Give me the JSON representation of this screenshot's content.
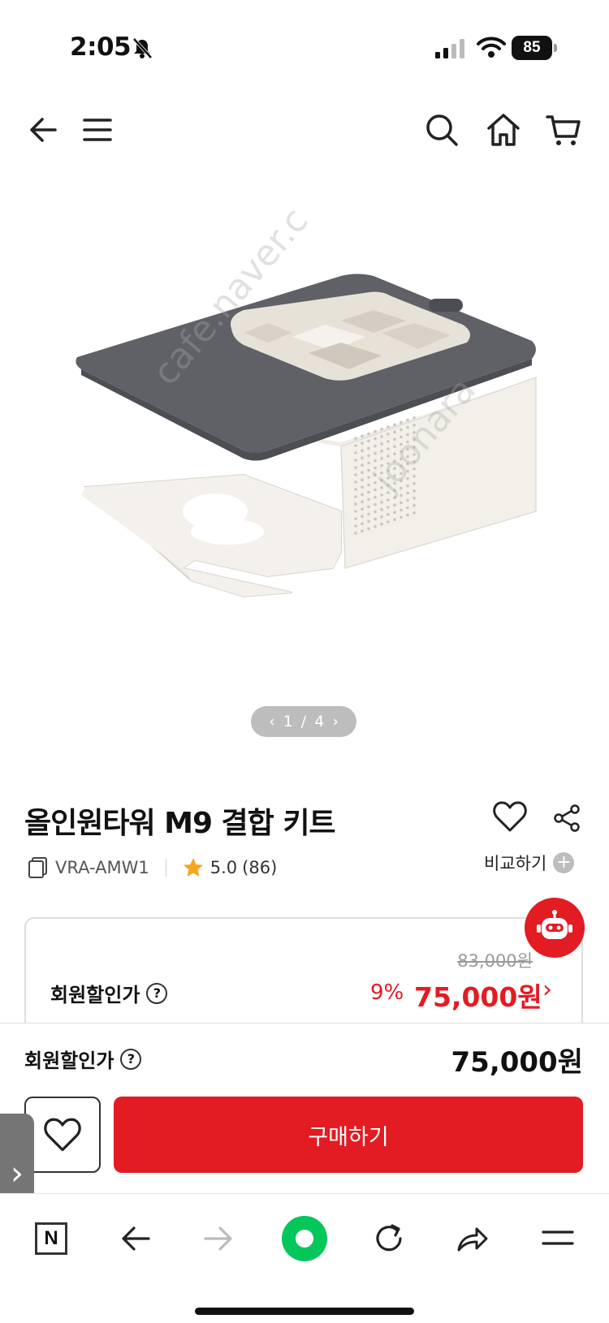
{
  "status_bar": {
    "time": "2:05",
    "battery": "85"
  },
  "nav": {
    "icons": [
      "back-arrow-icon",
      "menu-icon",
      "search-icon",
      "home-icon",
      "cart-icon"
    ]
  },
  "gallery": {
    "current": "1",
    "separator": "/",
    "total": "4"
  },
  "product": {
    "title": "올인원타워 M9 결합 키트",
    "model": "VRA-AMW1",
    "rating": "5.0",
    "review_count": "(86)",
    "compare_label": "비교하기"
  },
  "price": {
    "original": "83,000원",
    "member_label": "회원할인가",
    "discount_rate": "9%",
    "sale_price": "75,000원"
  },
  "buy_panel": {
    "member_label": "회원할인가",
    "price": "75,000원",
    "buy_label": "구매하기"
  },
  "browser": {
    "n_label": "N"
  },
  "colors": {
    "accent": "#e31b23",
    "green": "#03c75a"
  }
}
